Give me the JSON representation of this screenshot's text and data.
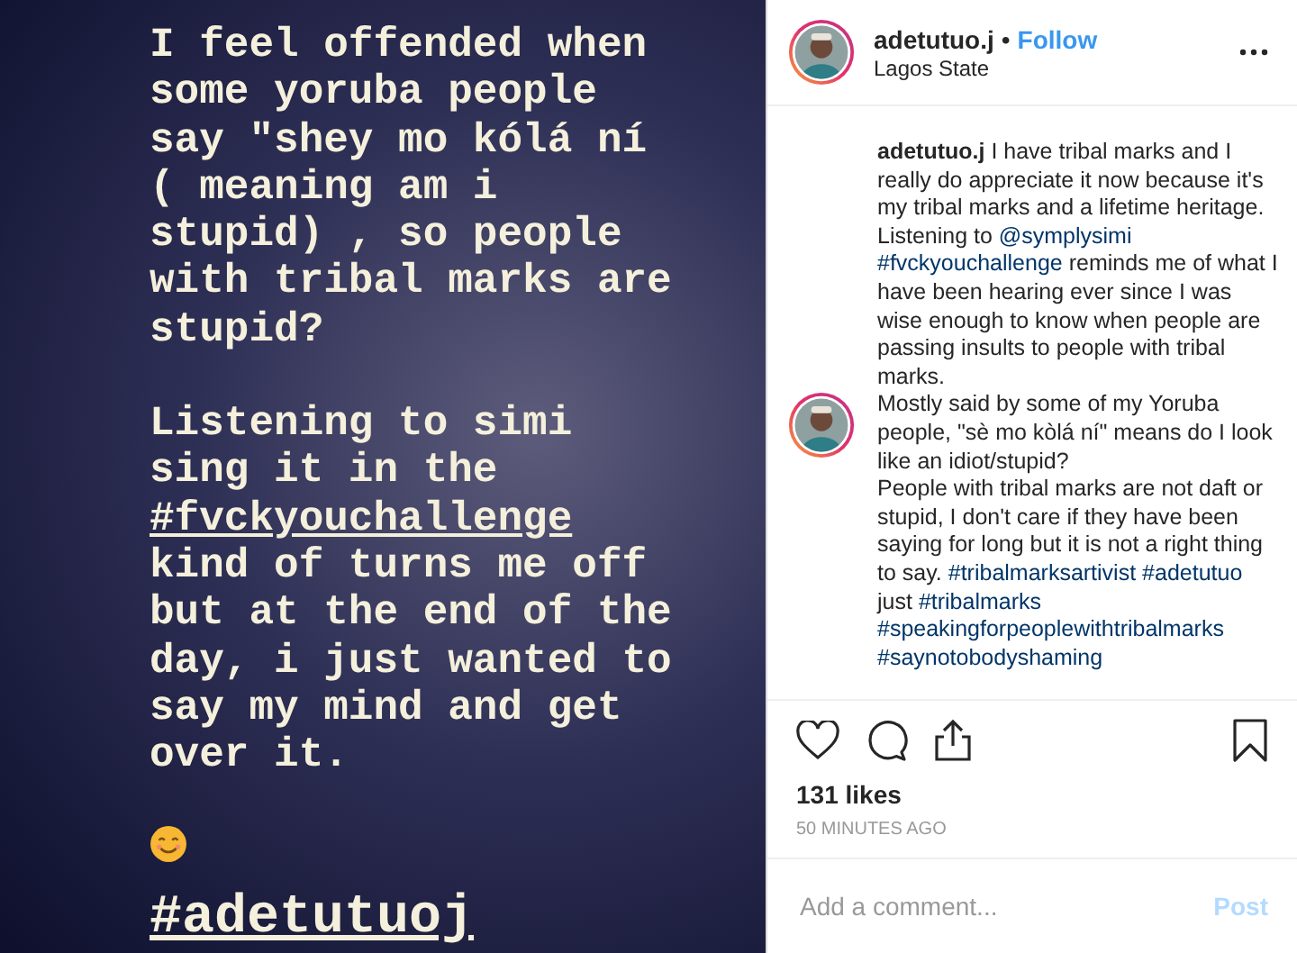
{
  "post_image": {
    "paragraphs": [
      [
        {
          "kind": "text",
          "text": "I feel offended when some yoruba people say \"shey mo kólá ní ( meaning am i stupid) , so people with tribal marks are stupid?"
        }
      ],
      [
        {
          "kind": "text",
          "text": "Listening to simi sing it in the "
        },
        {
          "kind": "hashtag",
          "text": "#fvckyouchallenge"
        },
        {
          "kind": "text",
          "text": " kind of turns me off but at the end of the day, i just wanted to say my mind and get over it."
        }
      ]
    ],
    "signature": "#adetutuoj"
  },
  "header": {
    "username": "adetutuo.j",
    "separator": "•",
    "follow": "Follow",
    "location": "Lagos State"
  },
  "caption": {
    "blocks": [
      {
        "avatar": false,
        "paragraphs": [
          [
            {
              "kind": "username",
              "text": "adetutuo.j"
            },
            {
              "kind": "text",
              "text": " I have tribal marks and I really do appreciate it now because it's my tribal marks and a lifetime heritage."
            }
          ],
          [
            {
              "kind": "text",
              "text": "Listening to "
            },
            {
              "kind": "mention",
              "text": "@symplysimi"
            },
            {
              "kind": "hashtag",
              "text": "#fvckyouchallenge"
            },
            {
              "kind": "text",
              "text": " reminds me of what I have been hearing ever since I was wise enough to know when people are passing insults to people with tribal marks."
            }
          ]
        ]
      },
      {
        "avatar": true,
        "paragraphs": [
          [
            {
              "kind": "text",
              "text": "Mostly said by some of my Yoruba people, \"sè mo kòlá ní\" means do I look like an idiot/stupid?"
            }
          ],
          [
            {
              "kind": "text",
              "text": "People with tribal marks are not daft or stupid, I don't care if they have been saying for long but it is not a right thing to say. "
            },
            {
              "kind": "hashtag",
              "text": "#tribalmarksartivist"
            },
            {
              "kind": "hashtag",
              "text": "#adetutuo"
            },
            {
              "kind": "text",
              "text": " just "
            },
            {
              "kind": "hashtag",
              "text": "#tribalmarks"
            },
            {
              "kind": "hashtag",
              "text": "#speakingforpeoplewithtribalmarks"
            },
            {
              "kind": "hashtag",
              "text": "#saynotobodyshaming"
            }
          ]
        ]
      }
    ]
  },
  "likes": "131 likes",
  "time": "50 MINUTES AGO",
  "comment": {
    "placeholder": "Add a comment...",
    "post": "Post",
    "post_disabled": true
  }
}
